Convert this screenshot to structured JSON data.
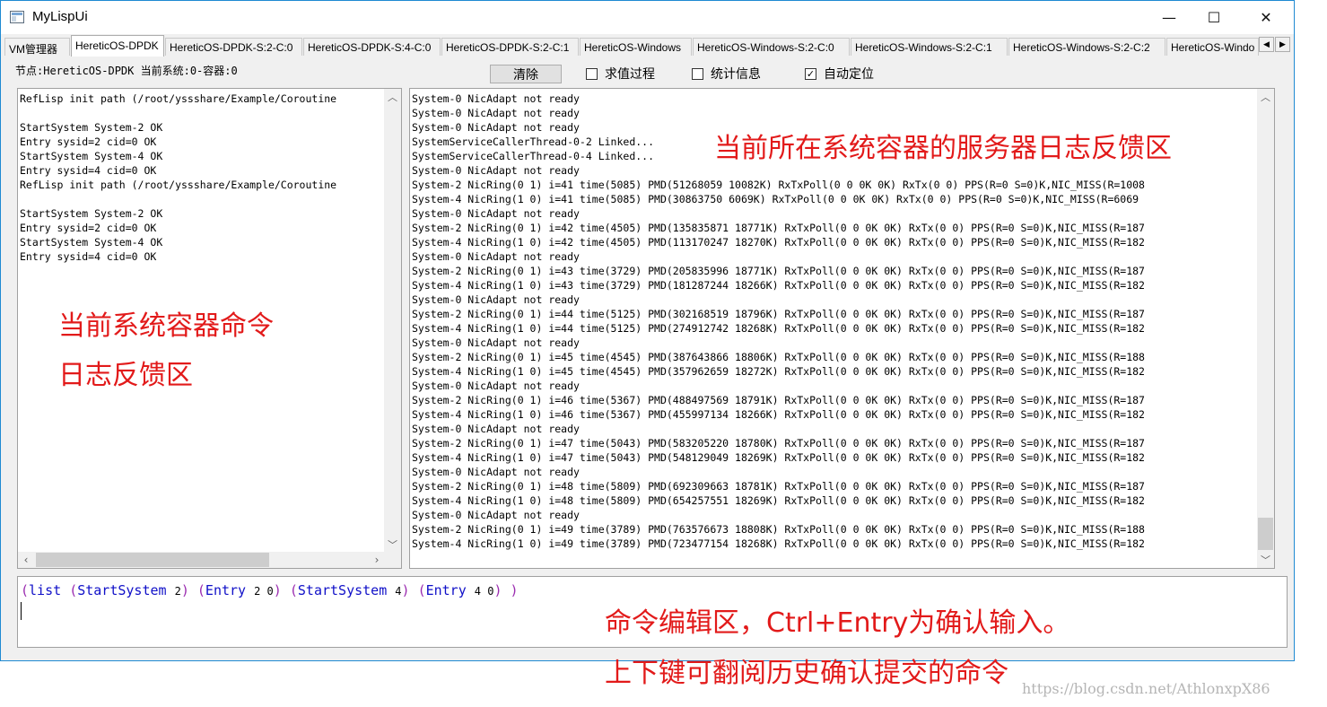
{
  "window": {
    "title": "MyLispUi",
    "minimize_glyph": "—",
    "maximize_glyph": "☐",
    "close_glyph": "✕"
  },
  "tabs": [
    {
      "label": "VM管理器",
      "active": false
    },
    {
      "label": "HereticOS-DPDK",
      "active": true
    },
    {
      "label": "HereticOS-DPDK-S:2-C:0",
      "active": false
    },
    {
      "label": "HereticOS-DPDK-S:4-C:0",
      "active": false
    },
    {
      "label": "HereticOS-DPDK-S:2-C:1",
      "active": false
    },
    {
      "label": "HereticOS-Windows",
      "active": false
    },
    {
      "label": "HereticOS-Windows-S:2-C:0",
      "active": false
    },
    {
      "label": "HereticOS-Windows-S:2-C:1",
      "active": false
    },
    {
      "label": "HereticOS-Windows-S:2-C:2",
      "active": false
    },
    {
      "label": "HereticOS-Windo",
      "active": false
    }
  ],
  "tab_scroll": {
    "left": "◀",
    "right": "▶"
  },
  "toolbar": {
    "status_text": "节点:HereticOS-DPDK 当前系统:0-容器:0",
    "clear_button": "清除",
    "checkboxes": [
      {
        "label": "求值过程",
        "checked": false
      },
      {
        "label": "统计信息",
        "checked": false
      },
      {
        "label": "自动定位",
        "checked": true
      }
    ]
  },
  "left_log": {
    "lines": [
      "RefLisp init path (/root/yssshare/Example/Coroutine",
      "",
      "StartSystem System-2 OK",
      "Entry sysid=2 cid=0 OK",
      "StartSystem System-4 OK",
      "Entry sysid=4 cid=0 OK",
      "RefLisp init path (/root/yssshare/Example/Coroutine",
      "",
      "StartSystem System-2 OK",
      "Entry sysid=2 cid=0 OK",
      "StartSystem System-4 OK",
      "Entry sysid=4 cid=0 OK"
    ]
  },
  "right_log": {
    "lines": [
      "System-0 NicAdapt not ready",
      "System-0 NicAdapt not ready",
      "System-0 NicAdapt not ready",
      "SystemServiceCallerThread-0-2 Linked...",
      "SystemServiceCallerThread-0-4 Linked...",
      "System-0 NicAdapt not ready",
      "System-2 NicRing(0 1) i=41 time(5085) PMD(51268059 10082K) RxTxPoll(0 0 0K 0K) RxTx(0 0) PPS(R=0 S=0)K,NIC_MISS(R=1008",
      "System-4 NicRing(1 0) i=41 time(5085) PMD(30863750 6069K) RxTxPoll(0 0 0K 0K) RxTx(0 0) PPS(R=0 S=0)K,NIC_MISS(R=6069",
      "System-0 NicAdapt not ready",
      "System-2 NicRing(0 1) i=42 time(4505) PMD(135835871 18771K) RxTxPoll(0 0 0K 0K) RxTx(0 0) PPS(R=0 S=0)K,NIC_MISS(R=187",
      "System-4 NicRing(1 0) i=42 time(4505) PMD(113170247 18270K) RxTxPoll(0 0 0K 0K) RxTx(0 0) PPS(R=0 S=0)K,NIC_MISS(R=182",
      "System-0 NicAdapt not ready",
      "System-2 NicRing(0 1) i=43 time(3729) PMD(205835996 18771K) RxTxPoll(0 0 0K 0K) RxTx(0 0) PPS(R=0 S=0)K,NIC_MISS(R=187",
      "System-4 NicRing(1 0) i=43 time(3729) PMD(181287244 18266K) RxTxPoll(0 0 0K 0K) RxTx(0 0) PPS(R=0 S=0)K,NIC_MISS(R=182",
      "System-0 NicAdapt not ready",
      "System-2 NicRing(0 1) i=44 time(5125) PMD(302168519 18796K) RxTxPoll(0 0 0K 0K) RxTx(0 0) PPS(R=0 S=0)K,NIC_MISS(R=187",
      "System-4 NicRing(1 0) i=44 time(5125) PMD(274912742 18268K) RxTxPoll(0 0 0K 0K) RxTx(0 0) PPS(R=0 S=0)K,NIC_MISS(R=182",
      "System-0 NicAdapt not ready",
      "System-2 NicRing(0 1) i=45 time(4545) PMD(387643866 18806K) RxTxPoll(0 0 0K 0K) RxTx(0 0) PPS(R=0 S=0)K,NIC_MISS(R=188",
      "System-4 NicRing(1 0) i=45 time(4545) PMD(357962659 18272K) RxTxPoll(0 0 0K 0K) RxTx(0 0) PPS(R=0 S=0)K,NIC_MISS(R=182",
      "System-0 NicAdapt not ready",
      "System-2 NicRing(0 1) i=46 time(5367) PMD(488497569 18791K) RxTxPoll(0 0 0K 0K) RxTx(0 0) PPS(R=0 S=0)K,NIC_MISS(R=187",
      "System-4 NicRing(1 0) i=46 time(5367) PMD(455997134 18266K) RxTxPoll(0 0 0K 0K) RxTx(0 0) PPS(R=0 S=0)K,NIC_MISS(R=182",
      "System-0 NicAdapt not ready",
      "System-2 NicRing(0 1) i=47 time(5043) PMD(583205220 18780K) RxTxPoll(0 0 0K 0K) RxTx(0 0) PPS(R=0 S=0)K,NIC_MISS(R=187",
      "System-4 NicRing(1 0) i=47 time(5043) PMD(548129049 18269K) RxTxPoll(0 0 0K 0K) RxTx(0 0) PPS(R=0 S=0)K,NIC_MISS(R=182",
      "System-0 NicAdapt not ready",
      "System-2 NicRing(0 1) i=48 time(5809) PMD(692309663 18781K) RxTxPoll(0 0 0K 0K) RxTx(0 0) PPS(R=0 S=0)K,NIC_MISS(R=187",
      "System-4 NicRing(1 0) i=48 time(5809) PMD(654257551 18269K) RxTxPoll(0 0 0K 0K) RxTx(0 0) PPS(R=0 S=0)K,NIC_MISS(R=182",
      "System-0 NicAdapt not ready",
      "System-2 NicRing(0 1) i=49 time(3789) PMD(763576673 18808K) RxTxPoll(0 0 0K 0K) RxTx(0 0) PPS(R=0 S=0)K,NIC_MISS(R=188",
      "System-4 NicRing(1 0) i=49 time(3789) PMD(723477154 18268K) RxTxPoll(0 0 0K 0K) RxTx(0 0) PPS(R=0 S=0)K,NIC_MISS(R=182"
    ]
  },
  "command": {
    "tokens": [
      {
        "text": "(",
        "kind": "paren"
      },
      {
        "text": "list",
        "kind": "kw"
      },
      {
        "text": " ",
        "kind": "sp"
      },
      {
        "text": "(",
        "kind": "paren"
      },
      {
        "text": "StartSystem",
        "kind": "kw"
      },
      {
        "text": " ",
        "kind": "sp"
      },
      {
        "text": "2",
        "kind": "num"
      },
      {
        "text": ")",
        "kind": "paren"
      },
      {
        "text": " ",
        "kind": "sp"
      },
      {
        "text": "(",
        "kind": "paren"
      },
      {
        "text": "Entry",
        "kind": "kw"
      },
      {
        "text": " ",
        "kind": "sp"
      },
      {
        "text": "2 0",
        "kind": "num"
      },
      {
        "text": ")",
        "kind": "paren"
      },
      {
        "text": " ",
        "kind": "sp"
      },
      {
        "text": "(",
        "kind": "paren"
      },
      {
        "text": "StartSystem",
        "kind": "kw"
      },
      {
        "text": " ",
        "kind": "sp"
      },
      {
        "text": "4",
        "kind": "num"
      },
      {
        "text": ")",
        "kind": "paren"
      },
      {
        "text": " ",
        "kind": "sp"
      },
      {
        "text": "(",
        "kind": "paren"
      },
      {
        "text": "Entry",
        "kind": "kw"
      },
      {
        "text": " ",
        "kind": "sp"
      },
      {
        "text": "4 0",
        "kind": "num"
      },
      {
        "text": ")",
        "kind": "paren"
      },
      {
        "text": " ",
        "kind": "sp"
      },
      {
        "text": ")",
        "kind": "paren"
      }
    ]
  },
  "annotations": {
    "server_log": "当前所在系统容器的服务器日志反馈区",
    "cmd_log_line1": "当前系统容器命令",
    "cmd_log_line2": "日志反馈区",
    "editor_line1": "命令编辑区，Ctrl+Entry为确认输入。",
    "editor_line2": "上下键可翻阅历史确认提交的命令"
  },
  "watermark": "https://blog.csdn.net/AthlonxpX86",
  "colors": {
    "annotation": "#e21a1a",
    "keyword": "#1010c8",
    "paren": "#9b2cb0"
  }
}
